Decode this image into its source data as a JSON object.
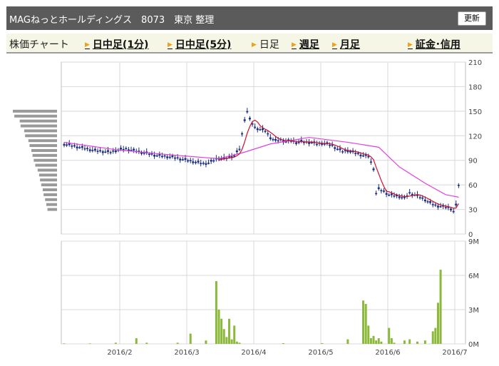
{
  "header": {
    "title": "MAGねっとホールディングス　8073　東京 整理",
    "refresh_label": "更新"
  },
  "nav": {
    "chart_label": "株価チャート",
    "intraday_1m": "日中足(1分)",
    "intraday_5m": "日中足(5分)",
    "daily": "日足",
    "weekly": "週足",
    "monthly": "月足",
    "margin": "証金･信用"
  },
  "colors": {
    "candle_down": "#1a2c80",
    "ma_line": "#e040e0",
    "ma_short": "#d01030",
    "volume_bar": "#8cb83c",
    "profile_bar": "#999999"
  },
  "chart_data": [
    {
      "type": "candlestick",
      "title": "",
      "y_ticks": [
        0,
        30,
        60,
        90,
        120,
        150,
        180,
        210
      ],
      "ylim": [
        0,
        210
      ],
      "x_ticks": [
        "2016/2",
        "2016/3",
        "2016/4",
        "2016/5",
        "2016/6",
        "2016/7"
      ],
      "grid": true,
      "close_series": [
        [
          0,
          110
        ],
        [
          3,
          108
        ],
        [
          6,
          106
        ],
        [
          9,
          104
        ],
        [
          12,
          102
        ],
        [
          15,
          101
        ],
        [
          18,
          100
        ],
        [
          21,
          103
        ],
        [
          24,
          104
        ],
        [
          27,
          102
        ],
        [
          30,
          100
        ],
        [
          33,
          98
        ],
        [
          36,
          96
        ],
        [
          39,
          95
        ],
        [
          42,
          94
        ],
        [
          45,
          92
        ],
        [
          48,
          90
        ],
        [
          51,
          88
        ],
        [
          54,
          86
        ],
        [
          56,
          87
        ],
        [
          58,
          90
        ],
        [
          60,
          93
        ],
        [
          62,
          92
        ],
        [
          64,
          94
        ],
        [
          66,
          96
        ],
        [
          68,
          104
        ],
        [
          70,
          140
        ],
        [
          71,
          150
        ],
        [
          72,
          140
        ],
        [
          74,
          130
        ],
        [
          76,
          128
        ],
        [
          78,
          126
        ],
        [
          80,
          118
        ],
        [
          82,
          114
        ],
        [
          84,
          115
        ],
        [
          86,
          113
        ],
        [
          88,
          114
        ],
        [
          90,
          112
        ],
        [
          92,
          113
        ],
        [
          94,
          112
        ],
        [
          96,
          112
        ],
        [
          98,
          110
        ],
        [
          100,
          111
        ],
        [
          102,
          110
        ],
        [
          104,
          108
        ],
        [
          106,
          104
        ],
        [
          108,
          101
        ],
        [
          110,
          102
        ],
        [
          112,
          100
        ],
        [
          114,
          98
        ],
        [
          116,
          96
        ],
        [
          118,
          95
        ],
        [
          120,
          80
        ],
        [
          121,
          50
        ],
        [
          122,
          55
        ],
        [
          124,
          52
        ],
        [
          126,
          48
        ],
        [
          128,
          47
        ],
        [
          130,
          46
        ],
        [
          132,
          44
        ],
        [
          134,
          50
        ],
        [
          136,
          48
        ],
        [
          138,
          45
        ],
        [
          140,
          42
        ],
        [
          142,
          38
        ],
        [
          144,
          35
        ],
        [
          146,
          34
        ],
        [
          148,
          33
        ],
        [
          150,
          31
        ],
        [
          151,
          28
        ],
        [
          152,
          35
        ],
        [
          153,
          60
        ]
      ],
      "long_ma": [
        [
          0,
          112
        ],
        [
          20,
          103
        ],
        [
          40,
          97
        ],
        [
          60,
          92
        ],
        [
          70,
          100
        ],
        [
          80,
          110
        ],
        [
          95,
          118
        ],
        [
          110,
          112
        ],
        [
          122,
          106
        ],
        [
          130,
          82
        ],
        [
          140,
          62
        ],
        [
          148,
          48
        ],
        [
          153,
          45
        ]
      ],
      "short_ma_from": 60,
      "price_profile": [
        148,
        143,
        125,
        122,
        110,
        107,
        96,
        92,
        86,
        82,
        78,
        73,
        65,
        60,
        57,
        53,
        48,
        45,
        40,
        36,
        32
      ],
      "volume": {
        "ylim": [
          0,
          9
        ],
        "y_ticks": [
          "0M",
          "3M",
          "6M",
          "9M"
        ],
        "units": "M",
        "bars": [
          [
            0,
            0.04
          ],
          [
            10,
            0.04
          ],
          [
            20,
            0.1
          ],
          [
            28,
            0.5
          ],
          [
            32,
            0.1
          ],
          [
            44,
            0.1
          ],
          [
            49,
            0.9
          ],
          [
            55,
            0.3
          ],
          [
            59,
            5.5
          ],
          [
            60,
            3.0
          ],
          [
            61,
            2.2
          ],
          [
            62,
            1.3
          ],
          [
            63,
            0.6
          ],
          [
            64,
            2.2
          ],
          [
            65,
            0.4
          ],
          [
            66,
            1.6
          ],
          [
            67,
            0.2
          ],
          [
            68,
            0.1
          ],
          [
            85,
            0.06
          ],
          [
            100,
            0.06
          ],
          [
            110,
            0.4
          ],
          [
            116,
            3.8
          ],
          [
            117,
            3.5
          ],
          [
            118,
            1.6
          ],
          [
            119,
            0.5
          ],
          [
            120,
            0.7
          ],
          [
            121,
            0.3
          ],
          [
            122,
            0.5
          ],
          [
            123,
            0.2
          ],
          [
            126,
            1.4
          ],
          [
            127,
            0.5
          ],
          [
            128,
            0.1
          ],
          [
            132,
            0.3
          ],
          [
            134,
            0.4
          ],
          [
            137,
            0.2
          ],
          [
            140,
            0.3
          ],
          [
            143,
            1.1
          ],
          [
            144,
            1.4
          ],
          [
            145,
            3.6
          ],
          [
            146,
            6.5
          ]
        ]
      }
    }
  ]
}
